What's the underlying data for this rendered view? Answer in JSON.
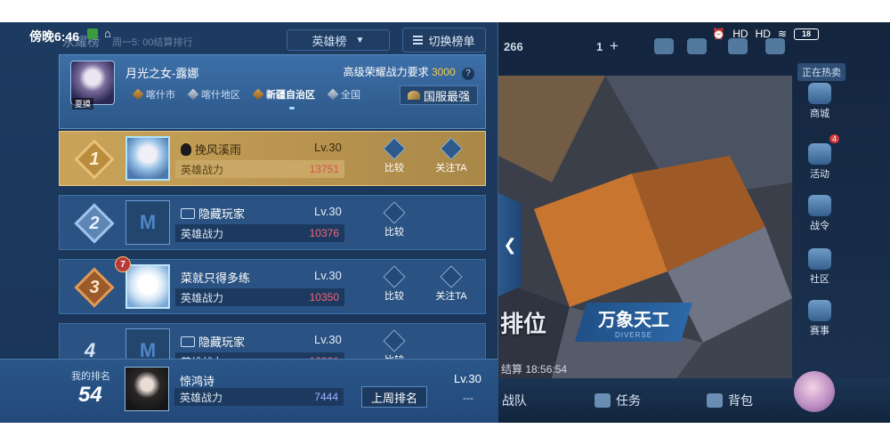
{
  "status_bar": {
    "time": "傍晚6:46",
    "app_icon": "wechat-like-icon",
    "home_icon": "⌂",
    "signal_1": "HD",
    "signal_2": "HD",
    "battery": "18"
  },
  "panel": {
    "title": "永耀榜",
    "subtitle": "周一5: 00结算排行",
    "dropdown": {
      "value": "英雄榜",
      "icon": "chevron-down-icon"
    },
    "switch_button": {
      "label": "切换榜单",
      "icon": "list-icon"
    }
  },
  "hero": {
    "name": "月光之女-露娜",
    "skin_tag": "夏摸",
    "requirement_label": "高级荣耀战力要求",
    "requirement_value": "3000",
    "help_icon": "?",
    "regions": [
      "喀什市",
      "喀什地区",
      "新疆自治区",
      "全国"
    ],
    "active_region": "新疆自治区",
    "national_button": "国服最强"
  },
  "rows": [
    {
      "rank": "1",
      "name": "挽风溪雨",
      "level": "Lv.30",
      "power_label": "英雄战力",
      "power": "13751",
      "compare": "比较",
      "follow": "关注TA",
      "avatar": "hero-avatar"
    },
    {
      "rank": "2",
      "name": "隐藏玩家",
      "level": "Lv.30",
      "power_label": "英雄战力",
      "power": "10376",
      "compare": "比较",
      "avatar": "hidden-avatar"
    },
    {
      "rank": "3",
      "name": "菜就只得多练",
      "level": "Lv.30",
      "power_label": "英雄战力",
      "power": "10350",
      "compare": "比较",
      "follow": "关注TA",
      "vip": "7",
      "avatar": "hero-avatar"
    },
    {
      "rank": "4",
      "name": "隐藏玩家",
      "level": "Lv.30",
      "power_label": "英雄战力",
      "power": "10321",
      "compare": "比较",
      "avatar": "hidden-avatar"
    }
  ],
  "my_rank": {
    "label": "我的排名",
    "rank": "54",
    "name": "惊鸿诗",
    "power_label": "英雄战力",
    "power": "7444",
    "last_week_button": "上周排名",
    "level": "Lv.30",
    "dash": "---"
  },
  "game": {
    "top_numbers": [
      "266",
      "1"
    ],
    "hot_label": "正在热卖",
    "side_items": [
      "商城",
      "活动",
      "战令",
      "社区",
      "赛事"
    ],
    "activity_badge": "4",
    "rank_text": "排位",
    "mode_button": {
      "title": "万象天工",
      "sub": "DIVERSE"
    },
    "timer": "结算 18:56:54",
    "nav": [
      "战队",
      "任务",
      "背包"
    ]
  },
  "colors": {
    "gold": "#c9a45a",
    "power_red": "#f2667a",
    "panel_bg": "#1d3a60",
    "accent_yellow": "#f4cc4a"
  }
}
